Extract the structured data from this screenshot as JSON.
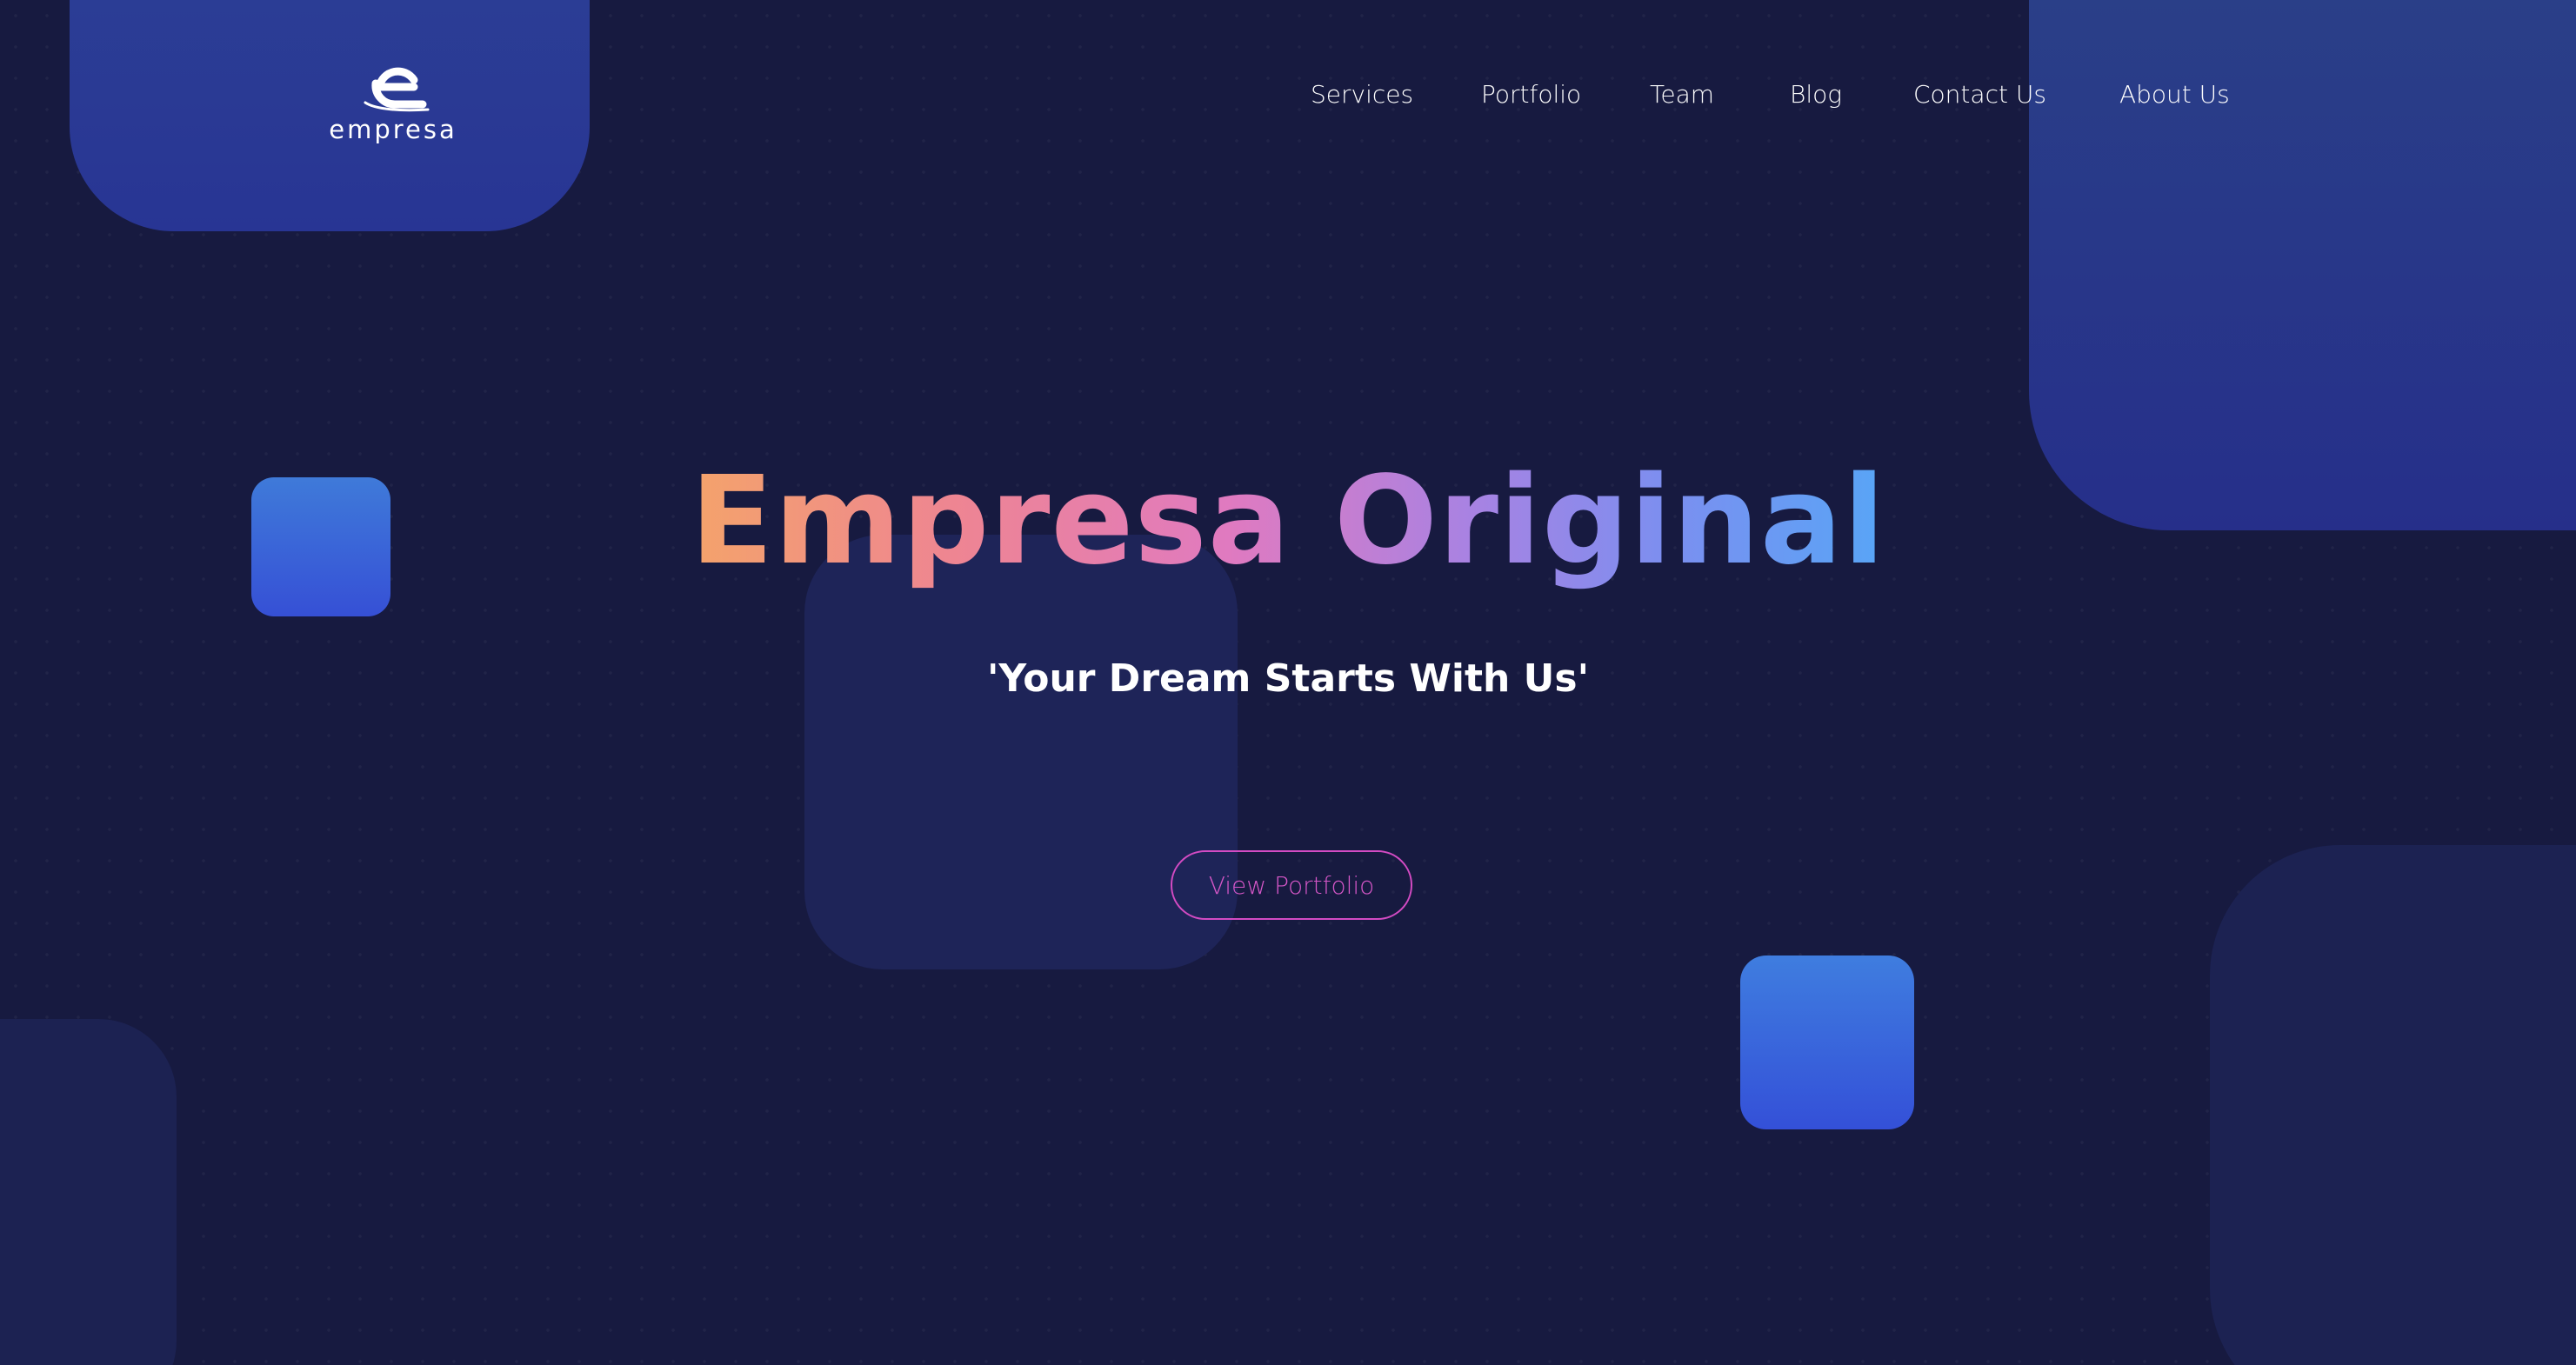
{
  "brand": {
    "name": "empresa",
    "logo_icon": "e-logo-icon"
  },
  "nav": {
    "items": [
      {
        "label": "Services"
      },
      {
        "label": "Portfolio"
      },
      {
        "label": "Team"
      },
      {
        "label": "Blog"
      },
      {
        "label": "Contact Us"
      },
      {
        "label": "About Us"
      }
    ]
  },
  "hero": {
    "title": "Empresa Original",
    "subtitle": "'Your Dream Starts With Us'",
    "cta_label": "View Portfolio"
  },
  "colors": {
    "background": "#171a40",
    "accent_blue": "#3650d6",
    "cta_border": "#d34bc3",
    "title_gradient": [
      "#f4a36b",
      "#ee8592",
      "#e07ac0",
      "#a982e2",
      "#58a5f6"
    ]
  }
}
